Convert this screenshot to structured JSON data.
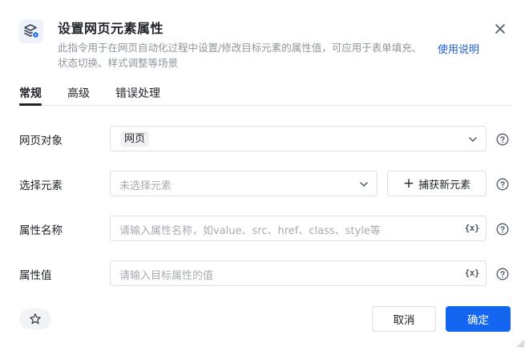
{
  "dialog": {
    "title": "设置网页元素属性",
    "description": "此指令用于在网页自动化过程中设置/修改目标元素的属性值，可应用于表单填充、状态切换、样式调整等场景",
    "help_link": "使用说明",
    "header_icon": "layers-gear-icon"
  },
  "tabs": [
    {
      "label": "常规",
      "active": true
    },
    {
      "label": "高级",
      "active": false
    },
    {
      "label": "错误处理",
      "active": false
    }
  ],
  "fields": {
    "web_object": {
      "label": "网页对象",
      "value": "网页"
    },
    "select_element": {
      "label": "选择元素",
      "placeholder": "未选择元素",
      "capture_label": "捕获新元素"
    },
    "attr_name": {
      "label": "属性名称",
      "placeholder": "请输入属性名称，如value、src、href、class、style等",
      "var_label": "{x}"
    },
    "attr_value": {
      "label": "属性值",
      "placeholder": "请输入目标属性的值",
      "var_label": "{x}"
    }
  },
  "footer": {
    "cancel_label": "取消",
    "confirm_label": "确定"
  },
  "colors": {
    "primary": "#1466f0",
    "link": "#1d5fd6",
    "border": "#dcdfe6"
  }
}
